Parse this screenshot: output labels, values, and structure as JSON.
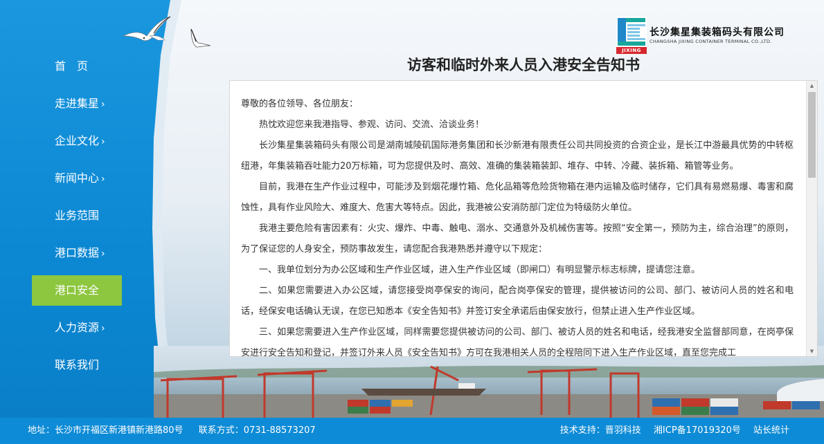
{
  "nav": {
    "items": [
      {
        "label": "首　页",
        "has_arrow": false
      },
      {
        "label": "走进集星",
        "has_arrow": true
      },
      {
        "label": "企业文化",
        "has_arrow": true
      },
      {
        "label": "新闻中心",
        "has_arrow": true
      },
      {
        "label": "业务范围",
        "has_arrow": false
      },
      {
        "label": "港口数据",
        "has_arrow": true
      },
      {
        "label": "港口安全",
        "has_arrow": false,
        "active": true
      },
      {
        "label": "人力资源",
        "has_arrow": true
      },
      {
        "label": "联系我们",
        "has_arrow": false
      }
    ],
    "arrow": "›",
    "active_color": "#8dc63f",
    "sidebar_color": "#0c88d3"
  },
  "logo": {
    "name_cn": "长沙集星集装箱码头有限公司",
    "name_en": "CHANGSHA JIXING CONTAINER TERMINAL CO.,LTD.",
    "badge": "JIXING"
  },
  "page": {
    "title": "访客和临时外来人员入港安全告知书"
  },
  "content": {
    "salutation": "尊敬的各位领导、各位朋友：",
    "paragraphs": [
      "热忱欢迎您来我港指导、参观、访问、交流、洽谈业务！",
      "长沙集星集装箱码头有限公司是湖南城陵矶国际港务集团和长沙新港有限责任公司共同投资的合资企业，是长江中游最具优势的中转枢纽港，年集装箱吞吐能力20万标箱，可为您提供及时、高效、准确的集装箱装卸、堆存、中转、冷藏、装拆箱、箱管等业务。",
      "目前，我港在生产作业过程中，可能涉及到烟花爆竹箱、危化品箱等危险货物箱在港内运输及临时储存，它们具有易燃易爆、毒害和腐蚀性，具有作业风险大、难度大、危害大等特点。因此，我港被公安消防部门定位为特级防火单位。",
      "我港主要危险有害因素有：火灾、爆炸、中毒、触电、溺水、交通意外及机械伤害等。按照“安全第一，预防为主，综合治理”的原则，为了保证您的人身安全，预防事故发生，请您配合我港熟悉并遵守以下规定：",
      "一、我单位划分为办公区域和生产作业区域，进入生产作业区域（即闸口）有明显警示标志标牌，提请您注意。",
      "二、如果您需要进入办公区域，请您接受岗亭保安的询问，配合岗亭保安的管理，提供被访问的公司、部门、被访问人员的姓名和电话，经保安电话确认无误，在您已知悉本《安全告知书》并签订安全承诺后由保安放行，但禁止进入生产作业区域。",
      "三、如果您需要进入生产作业区域，同样需要您提供被访问的公司、部门、被访人员的姓名和电话，经我港安全监督部同意，在岗亭保安进行安全告知和登记，并签订外来人员《安全告知书》方可在我港相关人员的全程陪同下进入生产作业区域，直至您完成工"
    ]
  },
  "scrollbar": {
    "up_arrow": "▲",
    "down_arrow": "▼"
  },
  "footer": {
    "address": "地址：长沙市开福区新港镇新港路80号",
    "contact": "联系方式：0731-88573207",
    "tech_support": "技术支持：晋羽科技",
    "icp": "湘ICP备17019320号",
    "stats": "站长统计"
  }
}
